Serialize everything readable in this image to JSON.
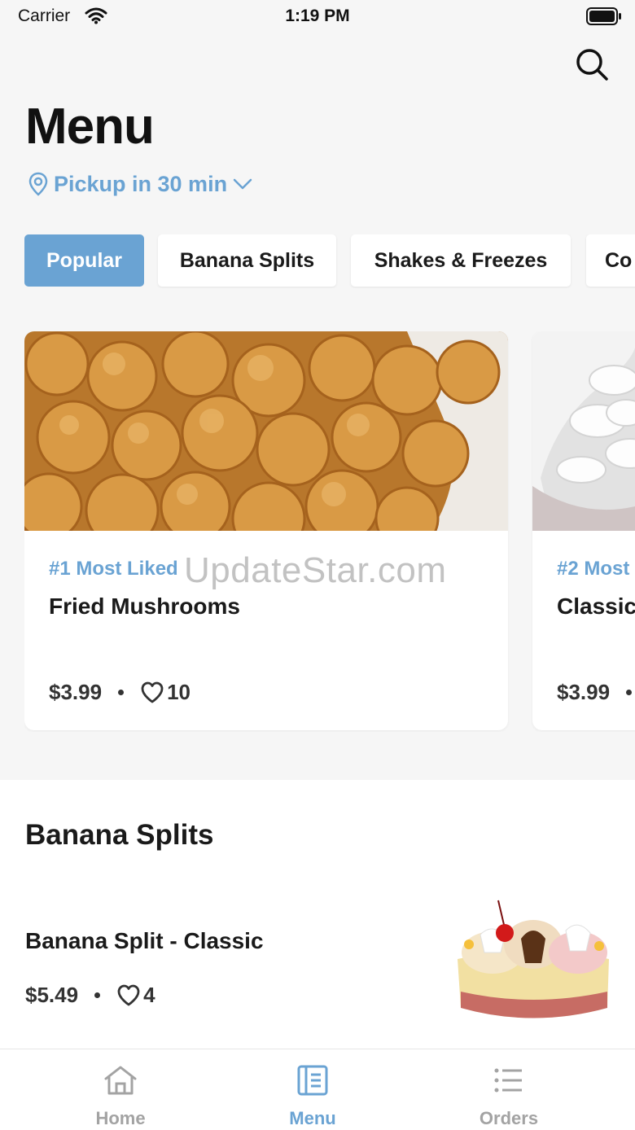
{
  "status_bar": {
    "carrier": "Carrier",
    "time": "1:19 PM"
  },
  "header": {
    "title": "Menu",
    "pickup": "Pickup in 30 min"
  },
  "tabs": [
    {
      "label": "Popular",
      "active": true
    },
    {
      "label": "Banana Splits",
      "active": false
    },
    {
      "label": "Shakes & Freezes",
      "active": false
    },
    {
      "label": "Co",
      "active": false
    }
  ],
  "popular_cards": [
    {
      "rank": "#1 Most Liked",
      "name": "Fried Mushrooms",
      "price": "$3.99",
      "likes": "10"
    },
    {
      "rank": "#2 Most",
      "name": "Classic",
      "price": "$3.99",
      "likes": ""
    }
  ],
  "watermark": "UpdateStar.com",
  "section": {
    "title": "Banana Splits",
    "items": [
      {
        "name": "Banana Split - Classic",
        "price": "$5.49",
        "likes": "4"
      }
    ]
  },
  "tabbar": [
    {
      "label": "Home",
      "icon": "home-icon",
      "active": false
    },
    {
      "label": "Menu",
      "icon": "menu-book-icon",
      "active": true
    },
    {
      "label": "Orders",
      "icon": "list-icon",
      "active": false
    }
  ],
  "colors": {
    "accent": "#6aa3d3",
    "background": "#f6f6f6",
    "inactive": "#a3a3a3"
  }
}
